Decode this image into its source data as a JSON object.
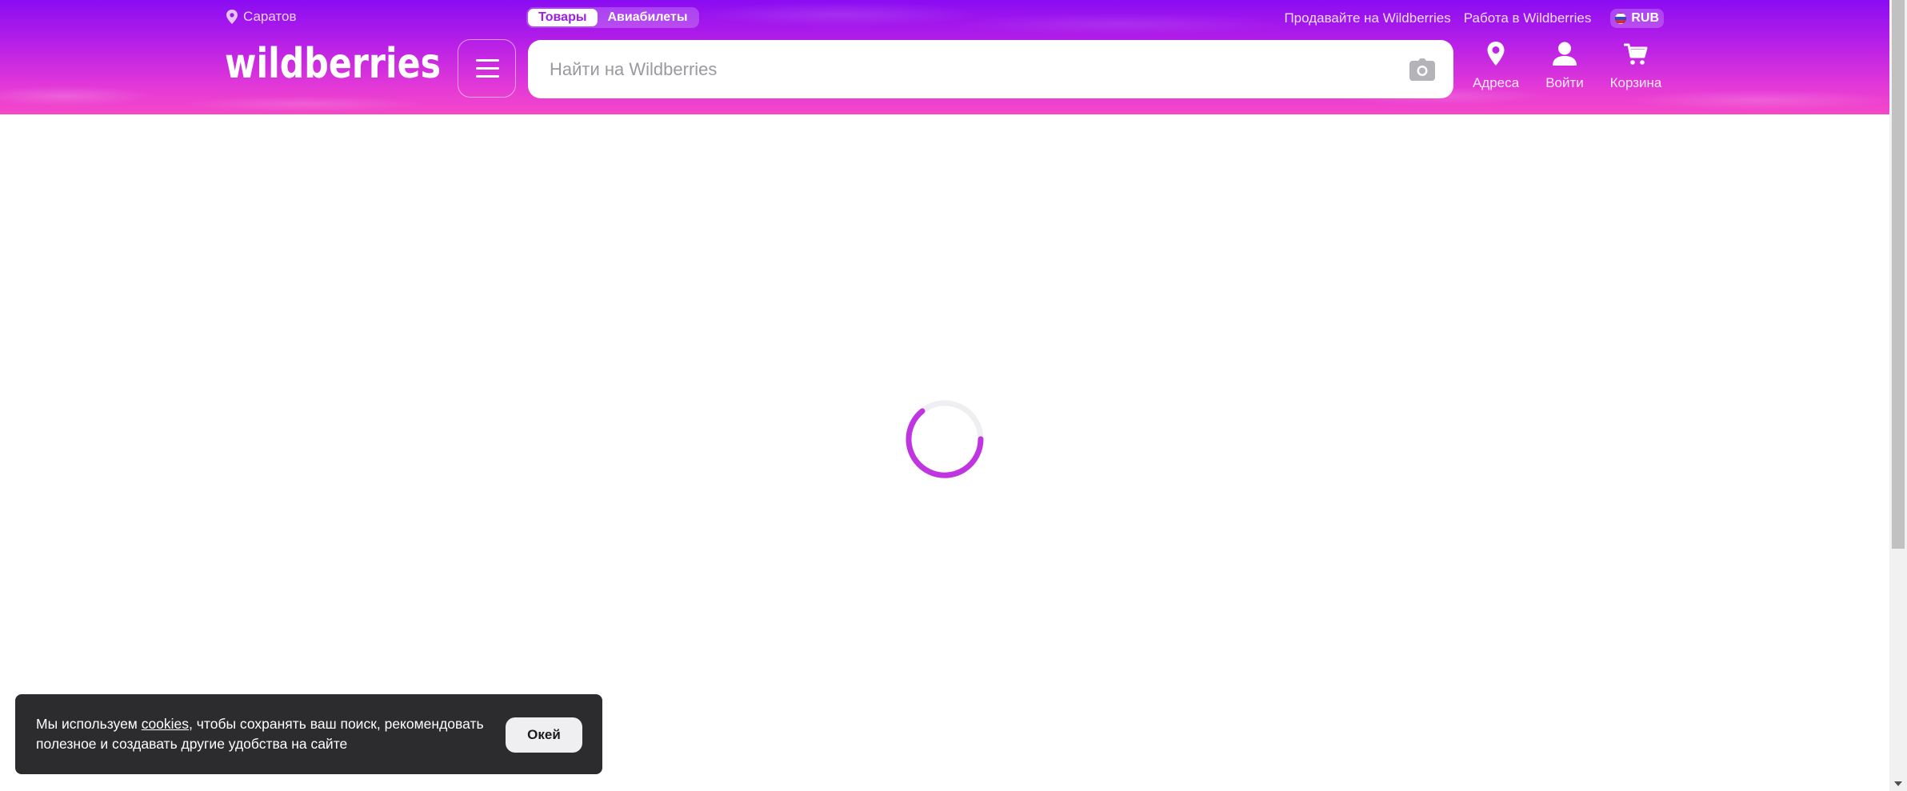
{
  "header": {
    "city": "Саратов",
    "segments": [
      {
        "label": "Товары",
        "active": true
      },
      {
        "label": "Авиабилеты",
        "active": false
      }
    ],
    "links": {
      "sell": "Продавайте на Wildberries",
      "work": "Работа в Wildberries"
    },
    "currency": "RUB",
    "logo_text": "wildberries",
    "search_placeholder": "Найти на Wildberries",
    "actions": {
      "addresses": "Адреса",
      "login": "Войти",
      "cart": "Корзина"
    }
  },
  "colors": {
    "accent": "#cb11ab",
    "spinner": "#c035e0",
    "header_top": "#8a0cf2",
    "header_bottom": "#f548c8"
  },
  "cookie": {
    "text_before": "Мы используем ",
    "link": "cookies",
    "text_after": ", чтобы сохранять ваш поиск, рекомендовать полезное и создавать другие удобства на сайте",
    "button": "Окей"
  },
  "icons": [
    "location-pin-icon",
    "menu-icon",
    "camera-icon",
    "address-pin-icon",
    "user-icon",
    "cart-icon",
    "loading-spinner",
    "russia-flag-icon"
  ]
}
